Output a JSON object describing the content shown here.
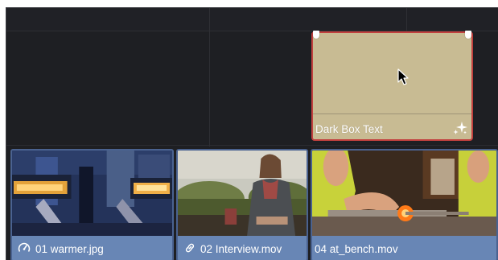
{
  "timeline": {
    "title_clip": {
      "label": "Dark Box Text",
      "icon": "sparkle-icon",
      "color": "#c8bb93",
      "selected_border": "#c2403e"
    },
    "video_clips": [
      {
        "label": "01 warmer.jpg",
        "icon": "speed-gauge-icon"
      },
      {
        "label": "02 Interview.mov",
        "icon": "link-icon"
      },
      {
        "label": "04 at_bench.mov",
        "icon": ""
      }
    ],
    "clip_color": "#6886b5"
  }
}
